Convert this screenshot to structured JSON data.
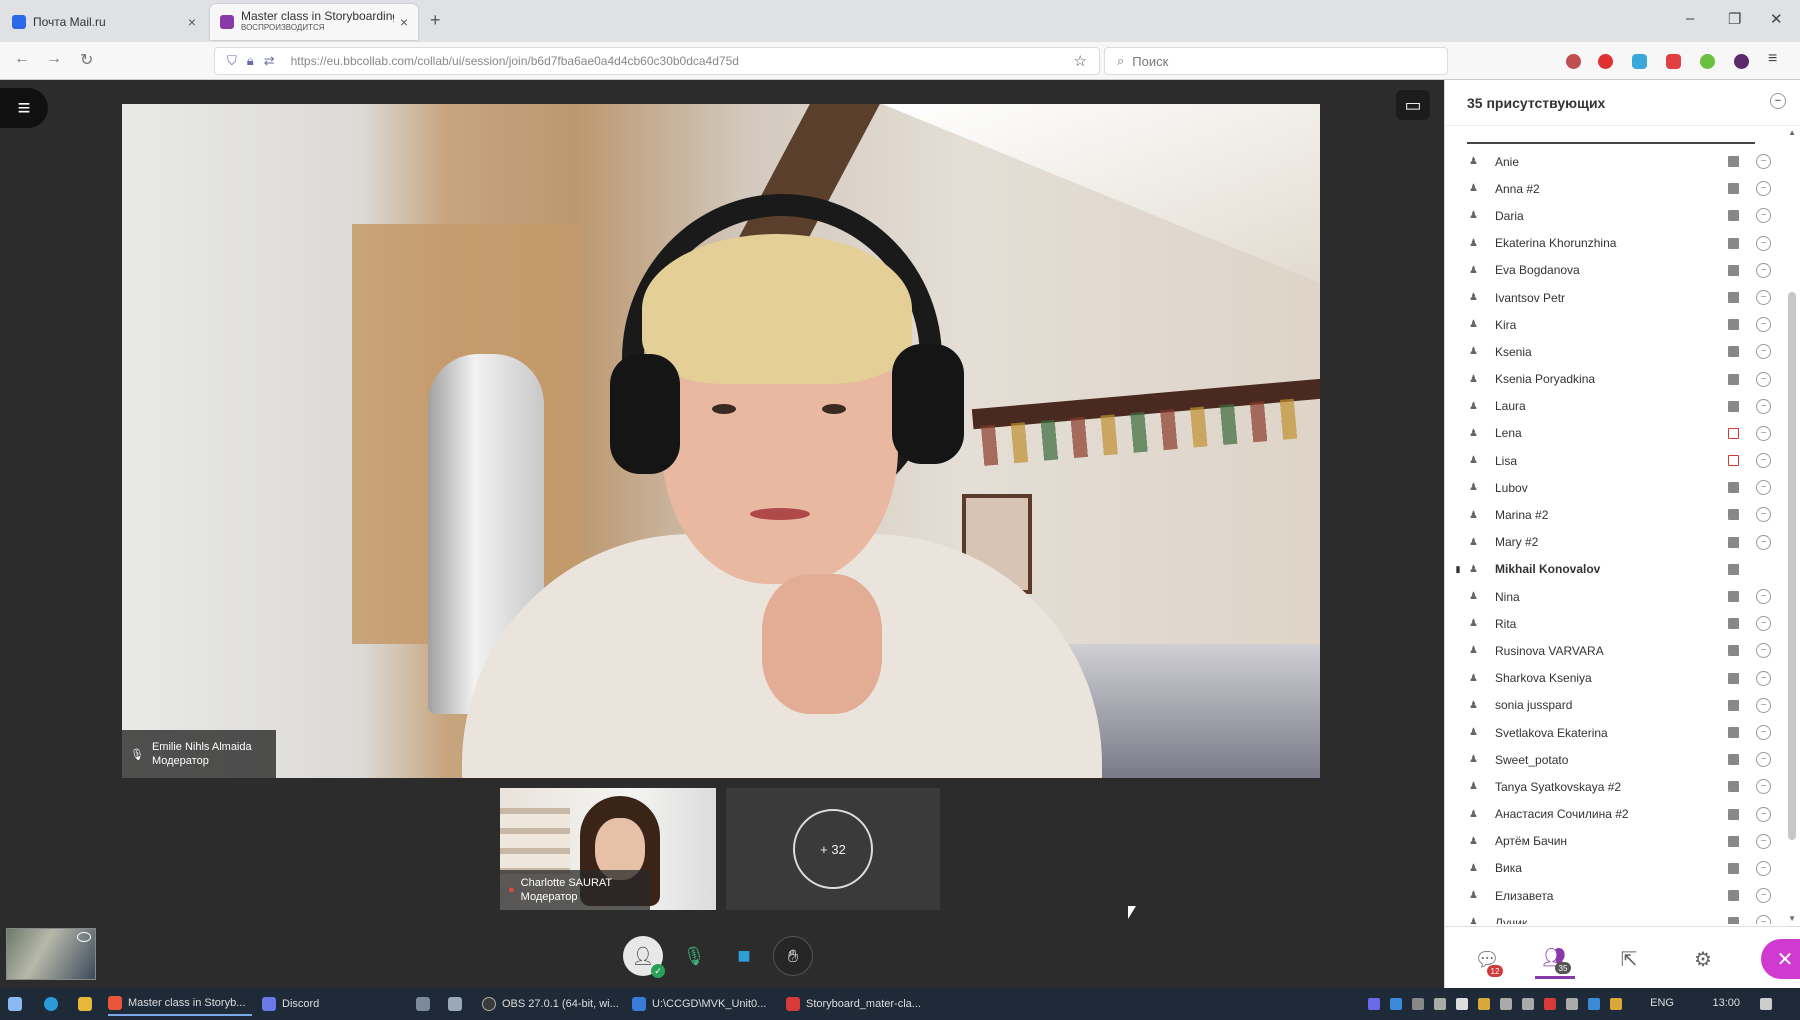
{
  "browser": {
    "tabs": [
      {
        "label": "Почта Mail.ru",
        "active": false
      },
      {
        "label": "Master class in Storyboarding",
        "sublabel": "ВОСПРОИЗВОДИТСЯ",
        "active": true
      }
    ],
    "url": "https://eu.bbcollab.com/collab/ui/session/join/b6d7fba6ae0a4d4cb60c30b0dca4d75d",
    "search_placeholder": "Поиск"
  },
  "stage": {
    "main_video": {
      "name": "Emilie Nihls Almaida",
      "role": "Модератор"
    },
    "thumbnail": {
      "name": "Charlotte SAURAT",
      "role": "Модератор"
    },
    "more_count": "+ 32"
  },
  "participants": {
    "header": "35 присутствующих",
    "items": [
      {
        "name": "Anie",
        "mute": "gray"
      },
      {
        "name": "Anna #2",
        "mute": "gray"
      },
      {
        "name": "Daria",
        "mute": "gray"
      },
      {
        "name": "Ekaterina Khorunzhina",
        "mute": "gray"
      },
      {
        "name": "Eva Bogdanova",
        "mute": "gray"
      },
      {
        "name": "Ivantsov Petr",
        "mute": "gray"
      },
      {
        "name": "Kira",
        "mute": "gray"
      },
      {
        "name": "Ksenia",
        "mute": "gray"
      },
      {
        "name": "Ksenia Poryadkina",
        "mute": "gray"
      },
      {
        "name": "Laura",
        "mute": "gray"
      },
      {
        "name": "Lena",
        "mute": "red"
      },
      {
        "name": "Lisa",
        "mute": "red"
      },
      {
        "name": "Lubov",
        "mute": "gray"
      },
      {
        "name": "Marina #2",
        "mute": "gray"
      },
      {
        "name": "Mary #2",
        "mute": "gray"
      },
      {
        "name": "Mikhail Konovalov",
        "mute": "gray",
        "self": true
      },
      {
        "name": "Nina",
        "mute": "gray"
      },
      {
        "name": "Rita",
        "mute": "gray"
      },
      {
        "name": "Rusinova VARVARA",
        "mute": "gray"
      },
      {
        "name": "Sharkova Kseniya",
        "mute": "gray"
      },
      {
        "name": "sonia jusspard",
        "mute": "gray"
      },
      {
        "name": "Svetlakova Ekaterina",
        "mute": "gray"
      },
      {
        "name": "Sweet_potato",
        "mute": "gray"
      },
      {
        "name": "Tanya Syatkovskaya #2",
        "mute": "gray"
      },
      {
        "name": "Анастасия Сочилина #2",
        "mute": "gray"
      },
      {
        "name": "Артём Бачин",
        "mute": "gray"
      },
      {
        "name": "Вика",
        "mute": "gray"
      },
      {
        "name": "Елизавета",
        "mute": "gray"
      },
      {
        "name": "Лучик",
        "mute": "gray"
      }
    ]
  },
  "sidebar_tabs": {
    "chat_badge": "12",
    "participants_badge": "35",
    "accent": "#8a3aa8",
    "leave_color": "#d03ad0"
  },
  "taskbar": {
    "items": [
      {
        "label": "Master class in Storyb...",
        "color": "#e8553a"
      },
      {
        "label": "Discord",
        "color": "#6a7ae8"
      },
      {
        "label": "OBS 27.0.1 (64-bit, wi...",
        "color": "#3a3a3a"
      },
      {
        "label": "U:\\CCGD\\MVK_Unit0...",
        "color": "#3a7ad8"
      },
      {
        "label": "Storyboard_mater-cla...",
        "color": "#d83a3a"
      }
    ],
    "lang": "ENG",
    "time": "13:00"
  }
}
